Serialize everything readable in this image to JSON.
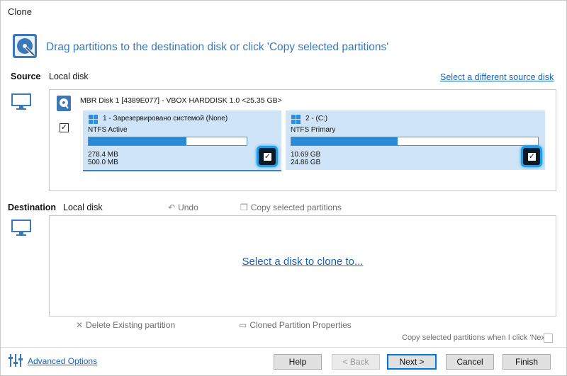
{
  "window": {
    "title": "Clone"
  },
  "header": {
    "text": "Drag partitions to the destination disk or click 'Copy selected partitions'"
  },
  "source": {
    "label": "Source",
    "sublabel": "Local disk",
    "change_link": "Select a different source disk",
    "disk_info": "MBR Disk 1 [4389E077] - VBOX HARDDISK 1.0  <25.35 GB>",
    "disk_checked": true,
    "partitions": [
      {
        "title": "1 - Зарезервировано системой (None)",
        "fs": "NTFS Active",
        "used": "278.4 MB",
        "total": "500.0 MB",
        "used_fraction": 0.62,
        "checked": true
      },
      {
        "title": "2 -  (C:)",
        "fs": "NTFS Primary",
        "used": "10.69 GB",
        "total": "24.86 GB",
        "used_fraction": 0.43,
        "checked": true
      }
    ]
  },
  "destination": {
    "label": "Destination",
    "sublabel": "Local disk",
    "undo": "Undo",
    "copy_selected": "Copy selected partitions",
    "select_link": "Select a disk to clone to...",
    "delete_existing": "Delete Existing partition",
    "cloned_props": "Cloned Partition Properties",
    "copy_on_next": "Copy selected partitions when I click 'Next'"
  },
  "footer": {
    "advanced": "Advanced Options",
    "help": "Help",
    "back": "< Back",
    "next": "Next >",
    "cancel": "Cancel",
    "finish": "Finish"
  },
  "colors": {
    "accent": "#3c78b6",
    "link": "#1a62b8",
    "partition_bg": "#cfe4f7",
    "usage_fill": "#2a8ad6",
    "highlight": "#1aa0ea"
  }
}
